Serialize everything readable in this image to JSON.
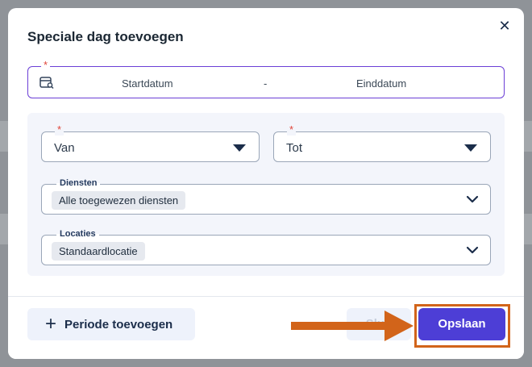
{
  "modal": {
    "title": "Speciale dag toevoegen",
    "close_glyph": "✕",
    "required_marker": "*"
  },
  "date_range": {
    "start_placeholder": "Startdatum",
    "separator": "-",
    "end_placeholder": "Einddatum",
    "icon": "calendar-search-icon"
  },
  "filters": {
    "from": {
      "value": "Van",
      "required": true
    },
    "to": {
      "value": "Tot",
      "required": true
    },
    "services": {
      "label": "Diensten",
      "selected": [
        "Alle toegewezen diensten"
      ]
    },
    "locations": {
      "label": "Locaties",
      "selected": [
        "Standaardlocatie"
      ]
    }
  },
  "footer": {
    "add_period_label": "Periode toevoegen",
    "close_label": "Sluit",
    "save_label": "Opslaan"
  },
  "colors": {
    "accent": "#4d3ed6",
    "focus_border": "#6b3fd6",
    "required": "#e0453a",
    "annotation": "#d2641a"
  }
}
